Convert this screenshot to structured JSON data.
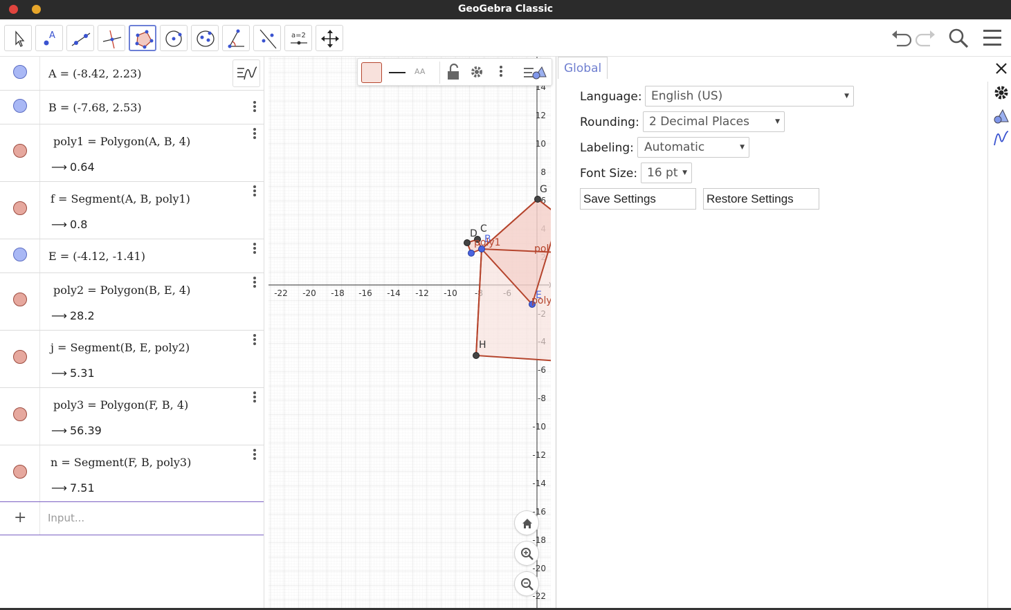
{
  "window": {
    "title": "GeoGebra Classic"
  },
  "algebra": {
    "rows": [
      {
        "def": "A = (-8.42, 2.23)"
      },
      {
        "def": "B = (-7.68, 2.53)"
      },
      {
        "def": "poly1 = Polygon(A, B, 4)",
        "value": "0.64"
      },
      {
        "def": "f = Segment(A, B, poly1)",
        "value": "0.8"
      },
      {
        "def": "E = (-4.12, -1.41)"
      },
      {
        "def": "poly2 = Polygon(B, E, 4)",
        "value": "28.2"
      },
      {
        "def": "j = Segment(B, E, poly2)",
        "value": "5.31"
      },
      {
        "def": "poly3 = Polygon(F, B, 4)",
        "value": "56.39"
      },
      {
        "def": "n = Segment(F, B, poly3)",
        "value": "7.51"
      }
    ],
    "input_placeholder": "Input...",
    "add_icon": "+"
  },
  "graphics": {
    "x_ticks": [
      "-22",
      "-20",
      "-18",
      "-16",
      "-14",
      "-12",
      "-10",
      "-8",
      "-6"
    ],
    "y_ticks": [
      "14",
      "12",
      "10",
      "8",
      "6",
      "4",
      "2",
      "-2",
      "-4",
      "-6",
      "-8",
      "-10",
      "-12",
      "-14",
      "-16",
      "-18",
      "-20",
      "-22"
    ],
    "point_labels": {
      "G": "G",
      "D": "D",
      "C": "C",
      "B": "B",
      "E": "E",
      "H": "H"
    },
    "poly_labels": {
      "poly1": "poly1",
      "pol": "pol",
      "poly": "poly"
    },
    "style_bar": {
      "font_label": "AA"
    }
  },
  "settings": {
    "tab": "Global",
    "language_label": "Language:",
    "language_value": "English (US)",
    "rounding_label": "Rounding:",
    "rounding_value": "2 Decimal Places",
    "labeling_label": "Labeling:",
    "labeling_value": "Automatic",
    "fontsize_label": "Font Size:",
    "fontsize_value": "16 pt",
    "save_button": "Save Settings",
    "restore_button": "Restore Settings"
  },
  "colors": {
    "accent": "#6c7fd6",
    "polygon_stroke": "#b5442c",
    "polygon_fill": "#f8e1dc",
    "point_blue": "#4a64e0"
  }
}
